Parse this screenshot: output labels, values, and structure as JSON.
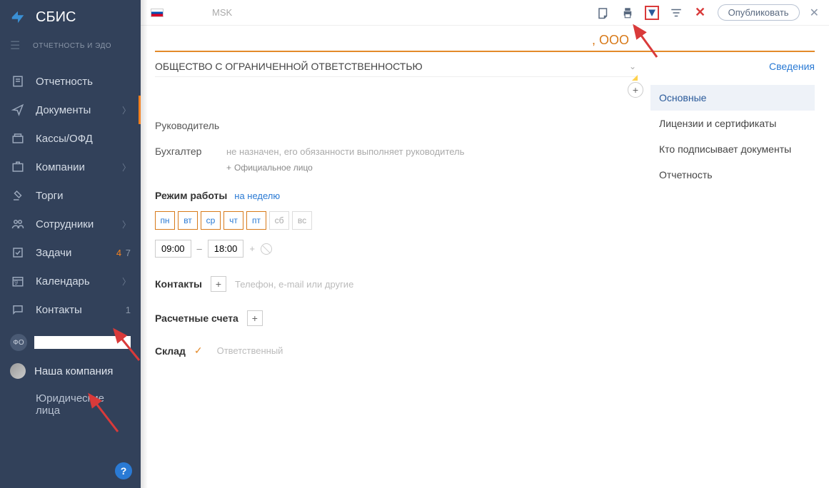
{
  "logo": "СБИС",
  "subtitle": "ОТЧЕТНОСТЬ И ЭДО",
  "nav": [
    {
      "label": "Отчетность",
      "icon": "report"
    },
    {
      "label": "Документы",
      "icon": "send",
      "arrow": true,
      "orange": true
    },
    {
      "label": "Кассы/ОФД",
      "icon": "cash"
    },
    {
      "label": "Компании",
      "icon": "company",
      "arrow": true
    },
    {
      "label": "Торги",
      "icon": "auction"
    },
    {
      "label": "Сотрудники",
      "icon": "people",
      "arrow": true
    },
    {
      "label": "Задачи",
      "icon": "tasks",
      "badge_o": "4",
      "badge_g": "7"
    },
    {
      "label": "Календарь",
      "icon": "calendar",
      "badge_small": "9",
      "arrow": true
    },
    {
      "label": "Контакты",
      "icon": "contacts",
      "badge_g": "1"
    }
  ],
  "user_badge": "ФО",
  "company_label": "Наша компания",
  "subitem_label": "Юридические лица",
  "help": "?",
  "header": {
    "city": "MSK",
    "publish": "Опубликовать"
  },
  "title_suffix": ", ООО",
  "org_type": "ОБЩЕСТВО С ОГРАНИЧЕННОЙ ОТВЕТСТВЕННОСТЬЮ",
  "fields": {
    "leader_label": "Руководитель",
    "accountant_label": "Бухгалтер",
    "accountant_value": "не назначен, его обязанности выполняет руководитель",
    "add_official": "Официальное лицо"
  },
  "schedule": {
    "title": "Режим работы",
    "link": "на неделю",
    "days": [
      "пн",
      "вт",
      "ср",
      "чт",
      "пт",
      "сб",
      "вс"
    ],
    "time_from": "09:00",
    "time_to": "18:00"
  },
  "contacts": {
    "label": "Контакты",
    "hint": "Телефон, e-mail или другие"
  },
  "accounts": {
    "label": "Расчетные счета"
  },
  "warehouse": {
    "label": "Склад",
    "hint": "Ответственный"
  },
  "right": {
    "info": "Сведения",
    "items": [
      "Основные",
      "Лицензии и сертификаты",
      "Кто подписывает документы",
      "Отчетность"
    ]
  }
}
